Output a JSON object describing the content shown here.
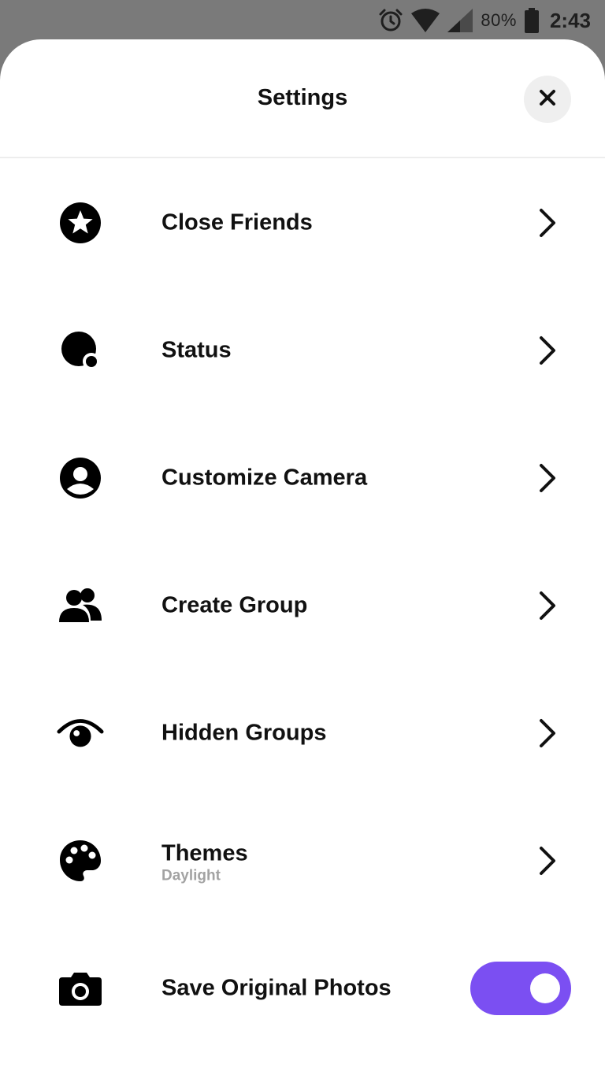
{
  "status_bar": {
    "battery_percent": "80%",
    "time": "2:43",
    "icons": [
      "alarm-icon",
      "wifi-icon",
      "cell-signal-icon",
      "battery-icon"
    ]
  },
  "sheet": {
    "title": "Settings",
    "close_icon": "close-icon"
  },
  "settings": {
    "items": [
      {
        "label": "Close Friends",
        "icon": "star-circle-icon"
      },
      {
        "label": "Status",
        "icon": "status-icon"
      },
      {
        "label": "Customize Camera",
        "icon": "person-circle-icon"
      },
      {
        "label": "Create Group",
        "icon": "group-icon"
      },
      {
        "label": "Hidden Groups",
        "icon": "eye-icon"
      },
      {
        "label": "Themes",
        "sublabel": "Daylight",
        "icon": "palette-icon"
      }
    ],
    "save_original_photos": {
      "label": "Save Original Photos",
      "icon": "camera-icon",
      "enabled": true
    }
  },
  "colors": {
    "status_bar_bg": "#7a7a7a",
    "toggle_on": "#7b4ff2",
    "subtext": "#a3a3a3"
  }
}
